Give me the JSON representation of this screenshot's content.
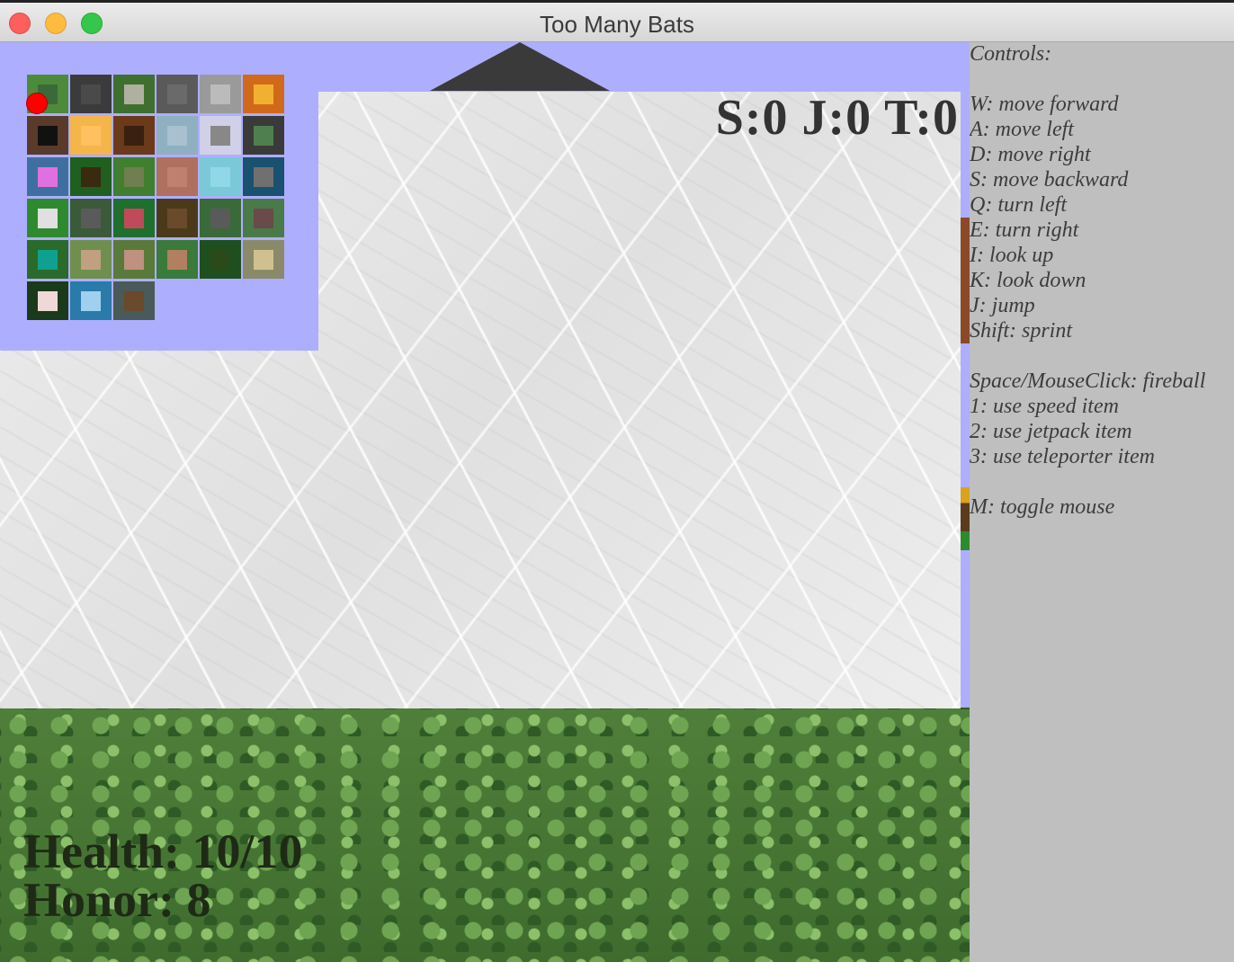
{
  "window": {
    "title": "Too Many Bats"
  },
  "hud": {
    "counts": "S:0 J:0 T:0",
    "health": "Health: 10/10",
    "honor": "Honor: 8"
  },
  "controls": {
    "heading": "Controls:",
    "movement": [
      "W: move forward",
      "A: move left",
      "D: move right",
      "S: move backward",
      "Q: turn left",
      "E: turn right",
      "I: look up",
      "K: look down",
      "J: jump",
      "Shift: sprint"
    ],
    "actions": [
      "Space/MouseClick: fireball",
      "1: use speed item",
      "2: use jetpack item",
      "3: use teleporter item"
    ],
    "mouse": "M: toggle mouse"
  },
  "minimap": {
    "tile_colors": [
      [
        "#4d8a3a",
        "#3b3b3b",
        "#3f6f2f",
        "#5a5a5a",
        "#9a9a9a",
        "#d06a1a",
        null
      ],
      [
        "#5a3a2a",
        "#f4b64a",
        "#6a3a1a",
        "#8fb0c0",
        "#d0d0e8",
        "#3a3a3a",
        null
      ],
      [
        "#3f6fa0",
        "#1f5f1f",
        "#3f7f2f",
        "#b07060",
        "#7ac8d8",
        "#1a5070",
        null
      ],
      [
        "#2f8a2f",
        "#3a5a3a",
        "#1f6f2f",
        "#4a3a1a",
        "#3a6a3a",
        "#4a7a4a",
        null
      ],
      [
        "#2a6a2a",
        "#6f8f4f",
        "#5a7a3a",
        "#3a7a3a",
        "#1f4f1f",
        "#8a8a6a",
        null
      ],
      [
        "#1a3a1a",
        "#2a7aaa",
        "#4a5a5a",
        null,
        null,
        null,
        null
      ]
    ],
    "tile_inner_colors": [
      [
        "#3a6a3a",
        "#4a4a4a",
        "#b0b0a0",
        "#6a6a6a",
        "#bbbbbb",
        "#f2b030",
        null
      ],
      [
        "#111111",
        "#ffc060",
        "#3a2010",
        "#a8c0d0",
        "#888888",
        "#4f7f4f",
        null
      ],
      [
        "#e070e0",
        "#3a2a10",
        "#6f7f4f",
        "#c08070",
        "#90d8e8",
        "#707070",
        null
      ],
      [
        "#e0e0e0",
        "#5a5a5a",
        "#c04a5a",
        "#6a4a2a",
        "#5a5a5a",
        "#6a4a4a",
        null
      ],
      [
        "#10a090",
        "#c0a080",
        "#c09080",
        "#b08060",
        "#2a4a1a",
        "#d0c090",
        null
      ],
      [
        "#f0d8d8",
        "#a0d0f0",
        "#6a4a2a",
        null,
        null,
        null,
        null
      ]
    ],
    "player_color": "#ff0000"
  }
}
